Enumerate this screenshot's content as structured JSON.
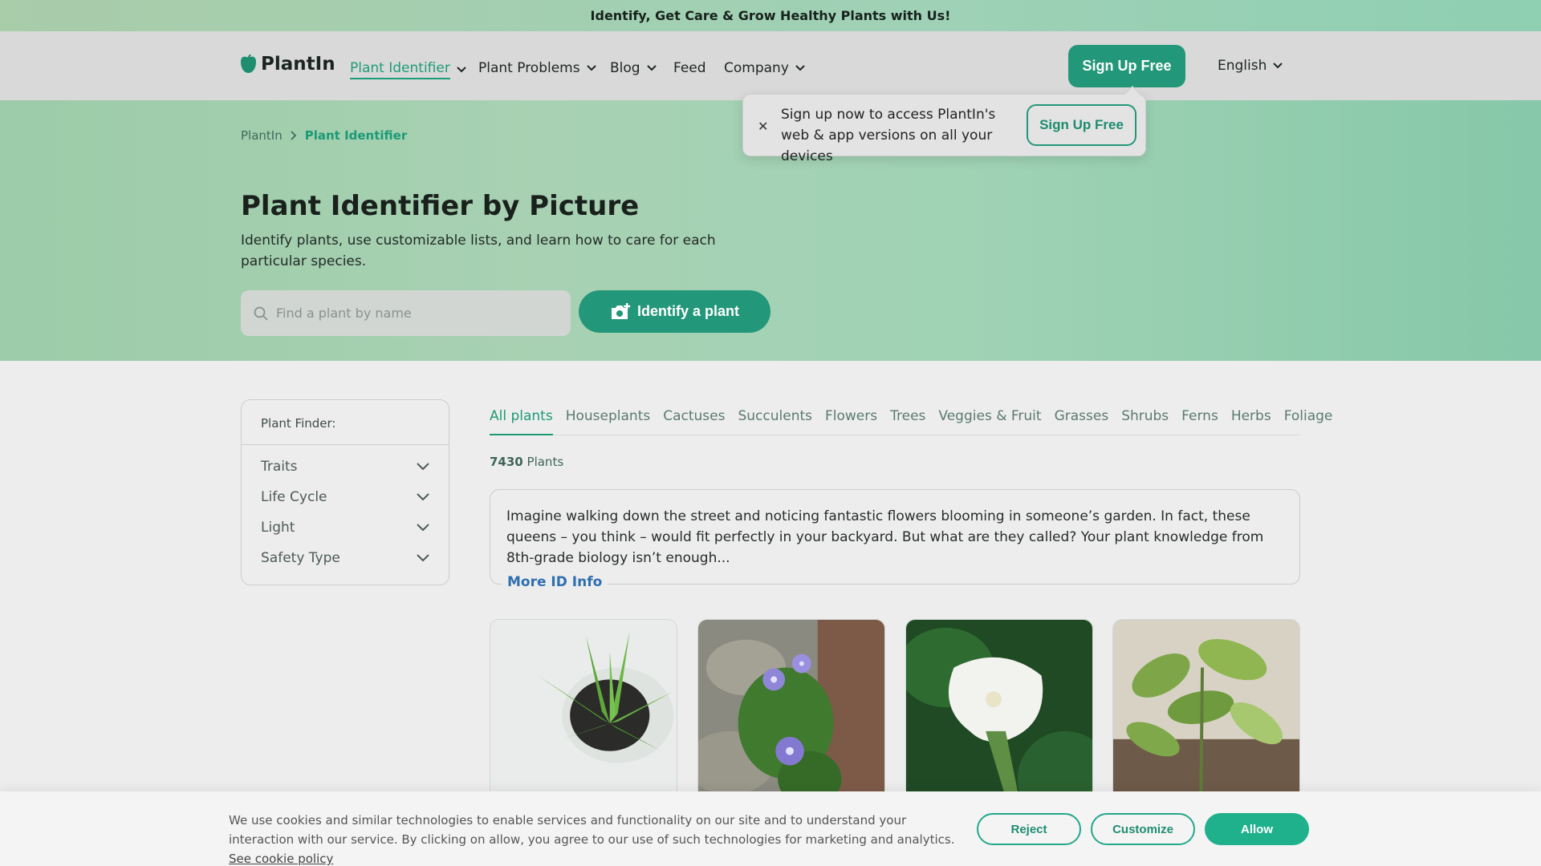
{
  "promo": {
    "text": "Identify, Get Care & Grow Healthy Plants with Us!"
  },
  "nav": {
    "logo": "PlantIn",
    "items": [
      {
        "label": "Plant Identifier",
        "dropdown": true,
        "active": true
      },
      {
        "label": "Plant Problems",
        "dropdown": true
      },
      {
        "label": "Blog",
        "dropdown": true
      },
      {
        "label": "Feed",
        "dropdown": false
      },
      {
        "label": "Company",
        "dropdown": true
      }
    ],
    "signup": "Sign Up Free",
    "language": "English"
  },
  "popover": {
    "close_icon": "close-icon",
    "text": "Sign up now to access PlantIn's web & app versions on all your devices",
    "button": "Sign Up Free"
  },
  "breadcrumb": {
    "home": "PlantIn",
    "current": "Plant Identifier"
  },
  "hero": {
    "title": "Plant Identifier by Picture",
    "description": "Identify plants, use customizable lists, and learn how to care for each particular species.",
    "search_placeholder": "Find a plant by name",
    "identify_button": "Identify a plant"
  },
  "finder": {
    "title": "Plant Finder:",
    "filters": [
      "Traits",
      "Life Cycle",
      "Light",
      "Safety Type"
    ]
  },
  "tabs": [
    "All plants",
    "Houseplants",
    "Cactuses",
    "Succulents",
    "Flowers",
    "Trees",
    "Veggies & Fruit",
    "Grasses",
    "Shrubs",
    "Ferns",
    "Herbs",
    "Foliage"
  ],
  "count": {
    "number": "7430",
    "label": "Plants"
  },
  "intro": {
    "text": "Imagine walking down the street and noticing fantastic flowers blooming in someone’s garden. In fact, these queens – you think – would fit perfectly in your backyard. But what are they called? Your plant knowledge from 8th-grade biology isn’t enough...",
    "more": "More ID Info"
  },
  "cards": [
    "aloe-plant-photo",
    "periwinkle-flowers-photo",
    "white-datura-flower-photo",
    "dieffenbachia-plant-photo"
  ],
  "cookie": {
    "text": "We use cookies and similar technologies to enable services and functionality on our site and to understand your interaction with our service. By clicking on allow, you agree to our use of such technologies for marketing and analytics.",
    "policy_link": "See cookie policy",
    "reject": "Reject",
    "customize": "Customize",
    "allow": "Allow"
  },
  "colors": {
    "brand": "#23977a",
    "accent_text": "#1c9a76",
    "link": "#2f6fb0"
  }
}
